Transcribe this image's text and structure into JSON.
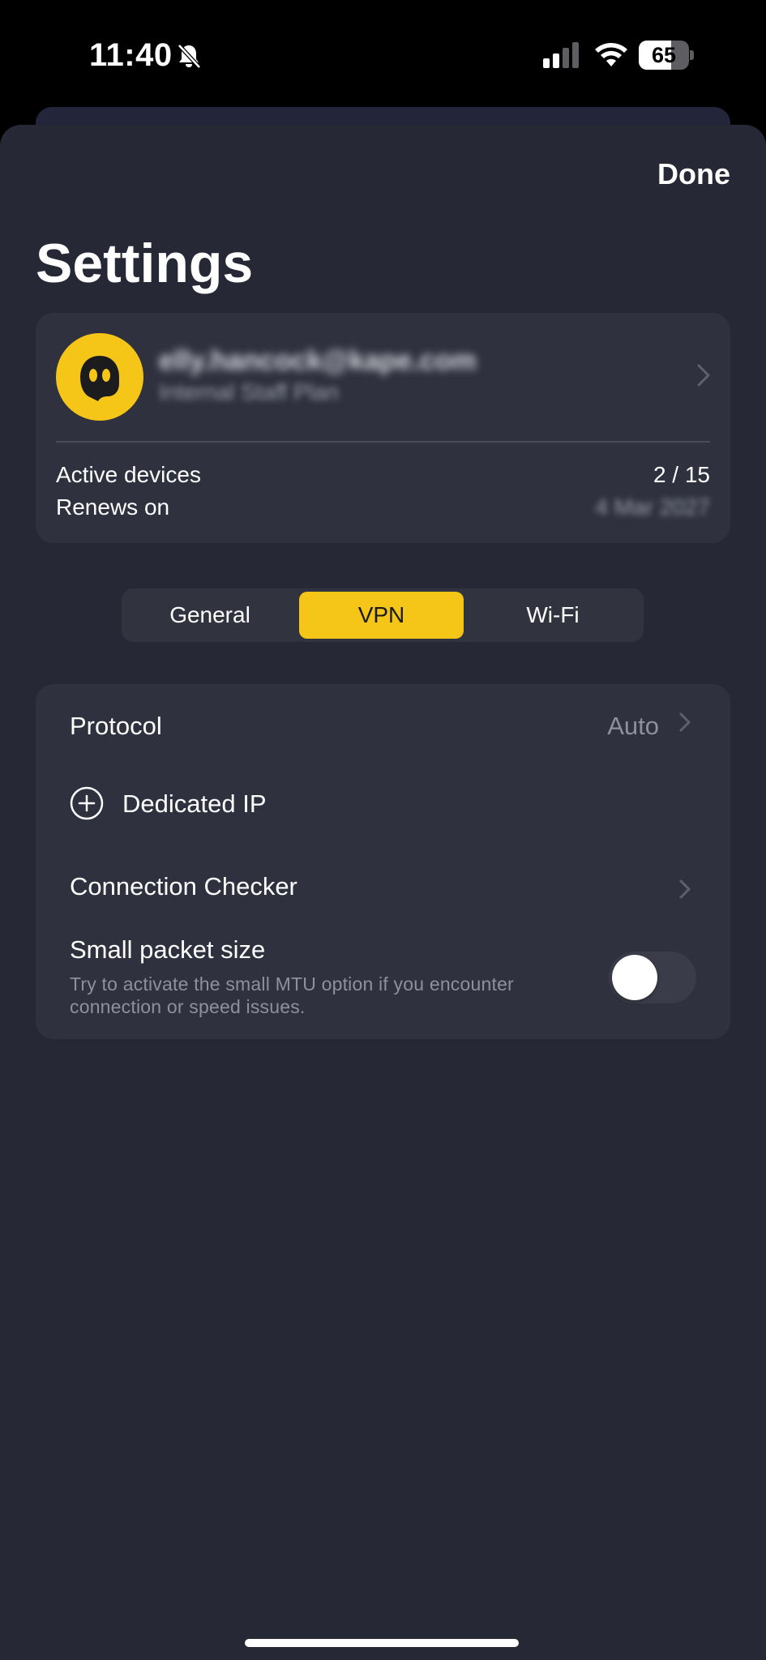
{
  "status_bar": {
    "time": "11:40",
    "battery_percent": "65",
    "battery_level": 0.65,
    "icons": [
      "bell-slash-icon",
      "cellular-signal-icon",
      "wifi-icon",
      "battery-icon"
    ]
  },
  "header": {
    "done_label": "Done",
    "title": "Settings"
  },
  "account": {
    "email": "elly.hancock@kape.com",
    "plan": "Internal Staff Plan",
    "active_devices_label": "Active devices",
    "active_devices_value": "2 / 15",
    "renews_label": "Renews on",
    "renews_value": "4 Mar 2027",
    "avatar_icon": "ghost-logo-icon"
  },
  "tabs": [
    {
      "label": "General",
      "selected": false
    },
    {
      "label": "VPN",
      "selected": true
    },
    {
      "label": "Wi-Fi",
      "selected": false
    }
  ],
  "vpn_settings": {
    "protocol_label": "Protocol",
    "protocol_value": "Auto",
    "dedicated_ip_label": "Dedicated IP",
    "connection_checker_label": "Connection Checker",
    "small_packet_label": "Small packet size",
    "small_packet_desc": "Try to activate the small MTU option if you encounter connection or speed issues.",
    "small_packet_enabled": false
  },
  "colors": {
    "accent": "#f5c518",
    "sheet_bg": "#262836",
    "card_bg": "#2f313f",
    "secondary_text": "#8e909c"
  }
}
